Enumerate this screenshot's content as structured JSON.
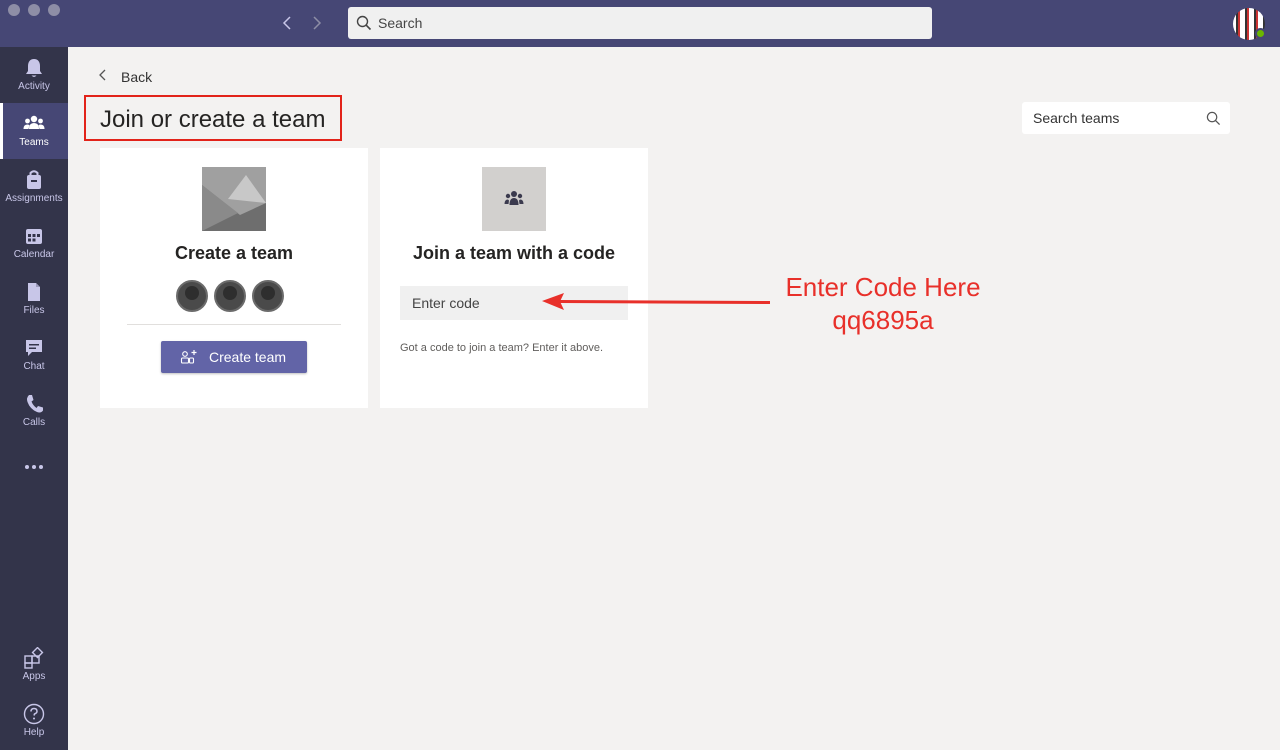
{
  "search": {
    "placeholder": "Search"
  },
  "sidebar": {
    "items": [
      {
        "label": "Activity",
        "icon": "bell-icon"
      },
      {
        "label": "Teams",
        "icon": "teams-icon"
      },
      {
        "label": "Assignments",
        "icon": "assignments-icon"
      },
      {
        "label": "Calendar",
        "icon": "calendar-icon"
      },
      {
        "label": "Files",
        "icon": "file-icon"
      },
      {
        "label": "Chat",
        "icon": "chat-icon"
      },
      {
        "label": "Calls",
        "icon": "phone-icon"
      },
      {
        "label": "Apps",
        "icon": "apps-icon"
      },
      {
        "label": "Help",
        "icon": "help-icon"
      }
    ],
    "more_icon": "ellipsis-icon"
  },
  "main": {
    "back_label": "Back",
    "page_title": "Join or create a team",
    "search_teams_placeholder": "Search teams",
    "create_card": {
      "title": "Create a team",
      "button_label": "Create team"
    },
    "join_card": {
      "title": "Join a team with a code",
      "code_placeholder": "Enter code",
      "hint": "Got a code to join a team? Enter it above."
    }
  },
  "annotation": {
    "line1": "Enter Code Here",
    "line2": "qq6895a",
    "color": "#e8302a"
  },
  "colors": {
    "titlebar": "#464775",
    "sidebar": "#33344a",
    "accent": "#6264a7",
    "highlight_box": "#e2231a"
  }
}
